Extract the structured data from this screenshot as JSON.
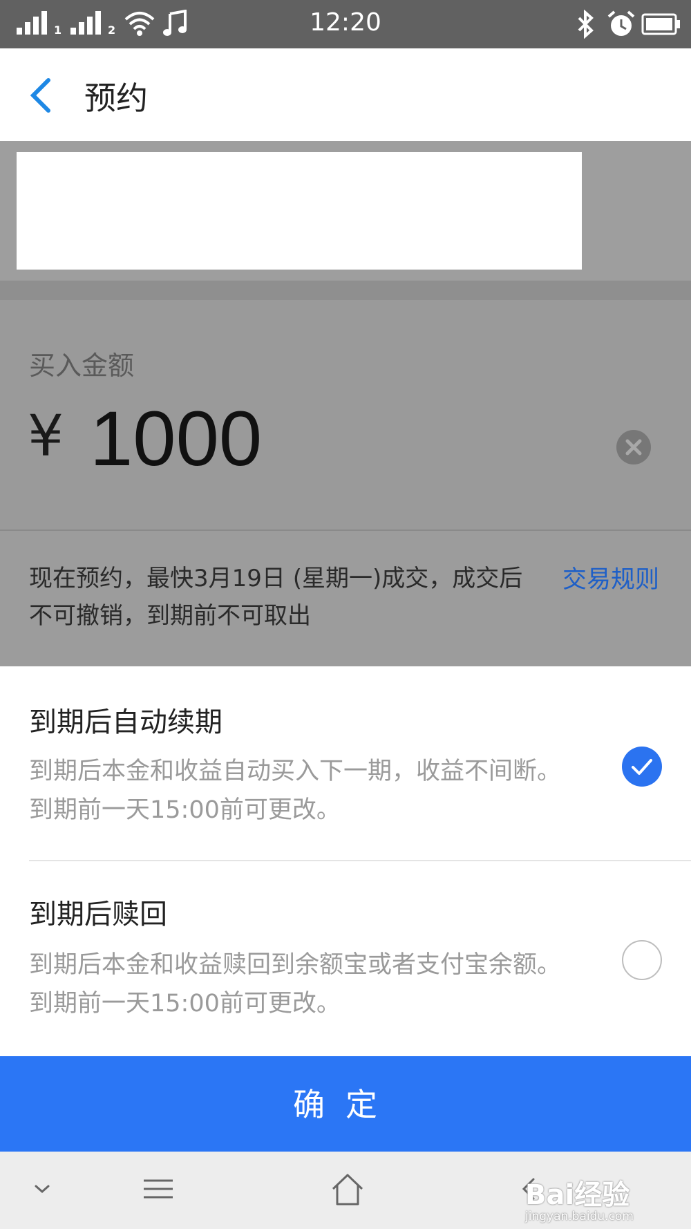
{
  "status_bar": {
    "time": "12:20",
    "sim1": "1",
    "sim2": "2",
    "icons": [
      "signal-icon",
      "wifi-icon",
      "music-note-icon",
      "bluetooth-icon",
      "alarm-icon",
      "battery-icon"
    ]
  },
  "header": {
    "back_icon": "chevron-left-icon",
    "title": "预约"
  },
  "amount": {
    "label": "买入金额",
    "currency": "¥",
    "value": "1000",
    "clear_icon": "clear-circle-icon"
  },
  "info": {
    "text": "现在预约，最快3月19日 (星期一)成交，成交后不可撤销，到期前不可取出",
    "rules_link": "交易规则"
  },
  "options": [
    {
      "title": "到期后自动续期",
      "description": "到期后本金和收益自动买入下一期，收益不间断。到期前一天15:00前可更改。",
      "selected": true
    },
    {
      "title": "到期后赎回",
      "description": "到期后本金和收益赎回到余额宝或者支付宝余额。到期前一天15:00前可更改。",
      "selected": false
    }
  ],
  "confirm_label": "确定",
  "nav_bar": {
    "icons": [
      "chevron-down-icon",
      "menu-icon",
      "home-icon",
      "back-icon"
    ]
  },
  "watermark": {
    "main": "Bai经验",
    "sub": "jingyan.baidu.com"
  },
  "colors": {
    "accent": "#2b76f5",
    "link": "#1e5fc7",
    "status_bar": "#616161",
    "dim_overlay": "#9c9c9c"
  }
}
